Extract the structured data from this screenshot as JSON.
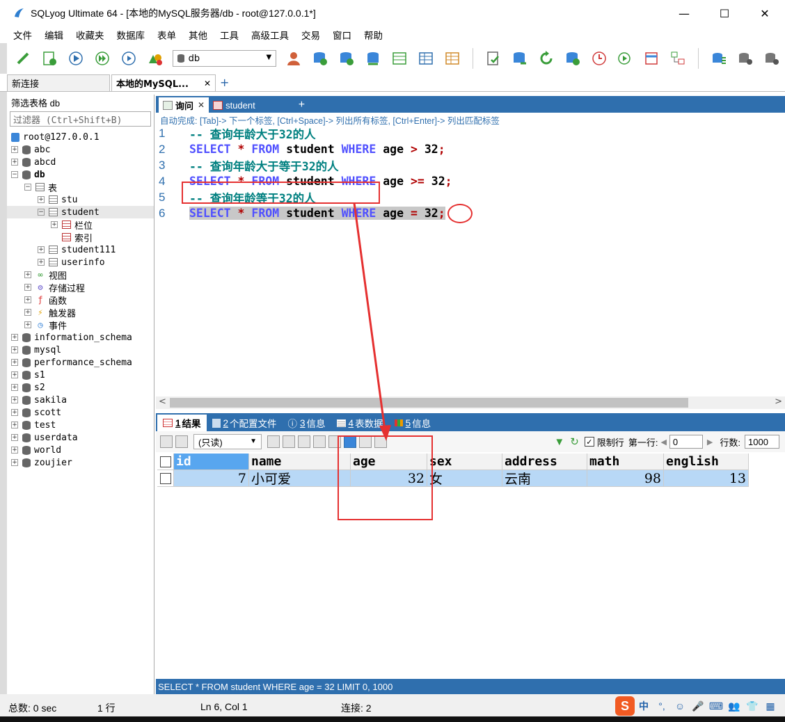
{
  "window": {
    "title": "SQLyog Ultimate 64 - [本地的MySQL服务器/db - root@127.0.0.1*]",
    "minimize": "—",
    "maximize": "☐",
    "close": "✕"
  },
  "menu": [
    "文件",
    "编辑",
    "收藏夹",
    "数据库",
    "表单",
    "其他",
    "工具",
    "高级工具",
    "交易",
    "窗口",
    "帮助"
  ],
  "toolbar": {
    "db_selected": "db"
  },
  "connection_tabs": [
    {
      "label": "新连接",
      "active": false
    },
    {
      "label": "本地的MySQL...",
      "active": true,
      "close": "✕"
    }
  ],
  "connection_tabs_add": "+",
  "sidebar": {
    "title": "筛选表格 db",
    "filter_placeholder": "过滤器 (Ctrl+Shift+B)",
    "tree": [
      {
        "label": "root@127.0.0.1",
        "level": 0,
        "icon": "server"
      },
      {
        "label": "abc",
        "level": 0,
        "icon": "database",
        "exp": "+"
      },
      {
        "label": "abcd",
        "level": 0,
        "icon": "database",
        "exp": "+"
      },
      {
        "label": "db",
        "level": 0,
        "icon": "database",
        "exp": "−",
        "bold": true
      },
      {
        "label": "表",
        "level": 1,
        "icon": "table",
        "exp": "−"
      },
      {
        "label": "stu",
        "level": 2,
        "icon": "table",
        "exp": "+"
      },
      {
        "label": "student",
        "level": 2,
        "icon": "table",
        "exp": "−",
        "selected": true
      },
      {
        "label": "栏位",
        "level": 3,
        "icon": "columns",
        "exp": "+"
      },
      {
        "label": "索引",
        "level": 3,
        "icon": "index"
      },
      {
        "label": "student111",
        "level": 2,
        "icon": "table",
        "exp": "+"
      },
      {
        "label": "userinfo",
        "level": 2,
        "icon": "table",
        "exp": "+"
      },
      {
        "label": "视图",
        "level": 1,
        "icon": "view",
        "exp": "+"
      },
      {
        "label": "存储过程",
        "level": 1,
        "icon": "procedure",
        "exp": "+"
      },
      {
        "label": "函数",
        "level": 1,
        "icon": "function",
        "exp": "+"
      },
      {
        "label": "触发器",
        "level": 1,
        "icon": "trigger",
        "exp": "+"
      },
      {
        "label": "事件",
        "level": 1,
        "icon": "event",
        "exp": "+"
      },
      {
        "label": "information_schema",
        "level": 0,
        "icon": "database",
        "exp": "+"
      },
      {
        "label": "mysql",
        "level": 0,
        "icon": "database",
        "exp": "+"
      },
      {
        "label": "performance_schema",
        "level": 0,
        "icon": "database",
        "exp": "+"
      },
      {
        "label": "s1",
        "level": 0,
        "icon": "database",
        "exp": "+"
      },
      {
        "label": "s2",
        "level": 0,
        "icon": "database",
        "exp": "+"
      },
      {
        "label": "sakila",
        "level": 0,
        "icon": "database",
        "exp": "+"
      },
      {
        "label": "scott",
        "level": 0,
        "icon": "database",
        "exp": "+"
      },
      {
        "label": "test",
        "level": 0,
        "icon": "database",
        "exp": "+"
      },
      {
        "label": "userdata",
        "level": 0,
        "icon": "database",
        "exp": "+"
      },
      {
        "label": "world",
        "level": 0,
        "icon": "database",
        "exp": "+"
      },
      {
        "label": "zoujier",
        "level": 0,
        "icon": "database",
        "exp": "+"
      }
    ]
  },
  "query_tabs": [
    {
      "label": "询问",
      "active": true,
      "close": "✕"
    },
    {
      "label": "student",
      "active": false
    }
  ],
  "query_tabs_add": "+",
  "editor": {
    "hint": "自动完成: [Tab]-> 下一个标签, [Ctrl+Space]-> 列出所有标签, [Ctrl+Enter]-> 列出匹配标签",
    "lines": [
      {
        "no": "1",
        "type": "comment",
        "text": "-- 查询年龄大于32的人"
      },
      {
        "no": "2",
        "type": "sql",
        "kw1": "SELECT",
        "star": "*",
        "kw2": "FROM",
        "table": "student",
        "kw3": "WHERE",
        "col": "age",
        "op": ">",
        "val": "32",
        "end": ";"
      },
      {
        "no": "3",
        "type": "comment",
        "text": "-- 查询年龄大于等于32的人"
      },
      {
        "no": "4",
        "type": "sql",
        "kw1": "SELECT",
        "star": "*",
        "kw2": "FROM",
        "table": "student",
        "kw3": "WHERE",
        "col": "age",
        "op": ">=",
        "val": "32",
        "end": ";"
      },
      {
        "no": "5",
        "type": "comment",
        "text": "-- 查询年龄等于32的人"
      },
      {
        "no": "6",
        "type": "sql",
        "kw1": "SELECT",
        "star": "*",
        "kw2": "FROM",
        "table": "student",
        "kw3": "WHERE",
        "col": "age",
        "op": "=",
        "val": "32",
        "end": ";",
        "highlight": true
      }
    ]
  },
  "scroll": {
    "left": "<",
    "right": ">"
  },
  "result_tabs": [
    {
      "num": "1",
      "label": "结果",
      "active": true
    },
    {
      "num": "2",
      "label": "个配置文件"
    },
    {
      "num": "3",
      "label": "信息"
    },
    {
      "num": "4",
      "label": "表数据"
    },
    {
      "num": "5",
      "label": "信息"
    }
  ],
  "result_toolbar": {
    "mode": "(只读)",
    "limit_label": "限制行",
    "limit_checked": "✓",
    "first_row_label": "第一行:",
    "first_row_value": "0",
    "rows_label": "行数:",
    "rows_value": "1000"
  },
  "grid": {
    "columns": [
      "id",
      "name",
      "age",
      "sex",
      "address",
      "math",
      "english"
    ],
    "rows": [
      [
        "7",
        "小可爱",
        "32",
        "女",
        "云南",
        "98",
        "13"
      ]
    ]
  },
  "sql_status": "SELECT * FROM student WHERE age = 32 LIMIT 0, 1000",
  "status": {
    "total": "总数: 0 sec",
    "rows": "1 行",
    "position": "Ln 6, Col 1",
    "connections": "连接: 2"
  },
  "tray": {
    "ime": "S",
    "lang": "中"
  },
  "colors": {
    "accent_blue": "#2f6fae",
    "annotation_red": "#e53030",
    "grid_row": "#b8d8f6",
    "grid_sel_header": "#58a6ef"
  }
}
